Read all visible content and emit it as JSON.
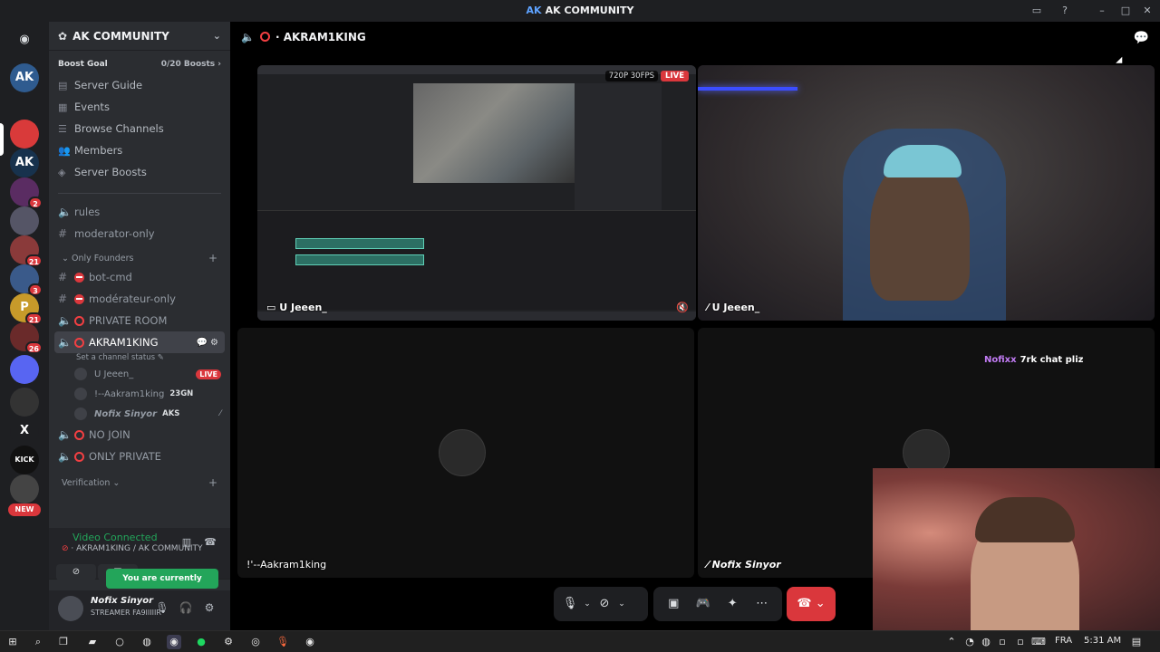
{
  "window": {
    "title": "AK COMMUNITY",
    "logo_text": "AK"
  },
  "rail": {
    "discord_icon": "discord-logo-icon",
    "servers": [
      {
        "abbr": "AK",
        "color": "#2f5b8f",
        "badge": ""
      },
      {
        "abbr": "",
        "color": "#d93a3a",
        "badge": ""
      },
      {
        "abbr": "AK",
        "color": "#17324d",
        "badge": ""
      },
      {
        "abbr": "",
        "color": "#5a2c62",
        "badge": "2"
      },
      {
        "abbr": "",
        "color": "#556",
        "badge": ""
      },
      {
        "abbr": "",
        "color": "#8a3a3a",
        "badge": "21"
      },
      {
        "abbr": "",
        "color": "#3a5a8a",
        "badge": "3"
      },
      {
        "abbr": "P",
        "color": "#c79a2a",
        "badge": "21"
      },
      {
        "abbr": "",
        "color": "#6a2a2a",
        "badge": "26"
      },
      {
        "abbr": "",
        "color": "#5865f2",
        "badge": ""
      },
      {
        "abbr": "",
        "color": "#333",
        "badge": ""
      },
      {
        "abbr": "X",
        "color": "#1e1f22",
        "badge": ""
      },
      {
        "abbr": "KICK",
        "color": "#111",
        "badge": ""
      },
      {
        "abbr": "",
        "color": "#444",
        "badge": ""
      }
    ],
    "new_label": "NEW"
  },
  "sidebar": {
    "server_name": "AK COMMUNITY",
    "boost_goal_label": "Boost Goal",
    "boost_goal_count": "0/20 Boosts",
    "nav": [
      {
        "label": "Server Guide",
        "icon": "server-guide-icon"
      },
      {
        "label": "Events",
        "icon": "calendar-icon"
      },
      {
        "label": "Browse Channels",
        "icon": "browse-channels-icon"
      },
      {
        "label": "Members",
        "icon": "members-icon"
      },
      {
        "label": "Server Boosts",
        "icon": "boost-icon"
      }
    ],
    "text_channels": [
      {
        "name": "rules"
      },
      {
        "name": "moderator-only"
      }
    ],
    "category_founders": "Only Founders",
    "founder_channels": [
      {
        "name": "bot-cmd",
        "type": "text"
      },
      {
        "name": "modérateur-only",
        "type": "text"
      },
      {
        "name": "PRIVATE ROOM",
        "type": "voice"
      }
    ],
    "active_channel": {
      "name": "AKRAM1KING",
      "status_hint": "Set a channel status"
    },
    "voice_users": [
      {
        "name": "U Jeeen_",
        "badge": "LIVE",
        "tag": ""
      },
      {
        "name": "!--Aakram1king",
        "badge": "",
        "tag": "23GN"
      },
      {
        "name": "Nofix Sinyor",
        "badge": "",
        "tag": "AKS"
      }
    ],
    "after_channels": [
      {
        "name": "NO JOIN"
      },
      {
        "name": "ONLY PRIVATE"
      }
    ],
    "category_verification": "Verification"
  },
  "voice_panel": {
    "status": "Video Connected",
    "location": "AKRAM1KING / AK COMMUNITY",
    "toast": "You are currently muted!"
  },
  "user_panel": {
    "name": "Nofix Sinyor",
    "subtitle": "STREAMER FA9IIIIIR"
  },
  "stage": {
    "channel_name": "AKRAM1KING",
    "tiles": [
      {
        "label": "U Jeeen_",
        "res": "720P 30FPS",
        "live": "LIVE"
      },
      {
        "label": "U Jeeen_"
      },
      {
        "label": "!'--Aakram1king"
      },
      {
        "label": "Nofix Sinyor"
      }
    ],
    "chat_overlay": {
      "name": "Nofixx",
      "text": "7rk chat pliz"
    }
  },
  "taskbar": {
    "lang": "FRA",
    "time": "5:31 AM"
  }
}
